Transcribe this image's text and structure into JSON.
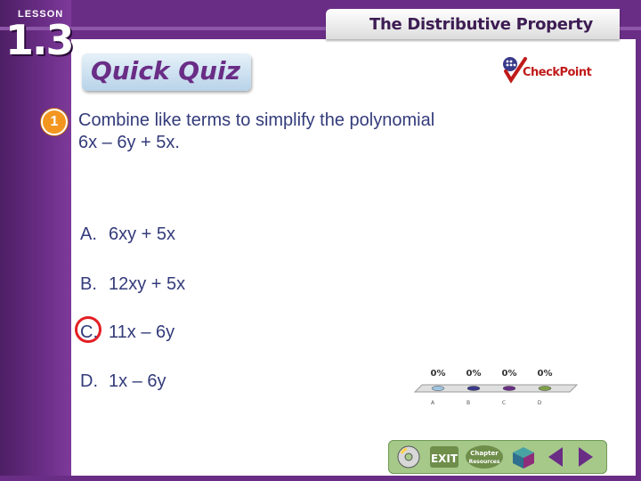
{
  "lesson": {
    "label": "LESSON",
    "number": "1.3"
  },
  "header": {
    "title": "The Distributive Property"
  },
  "quiz": {
    "heading": "Quick Quiz"
  },
  "checkpoint": {
    "label": "CheckPoint"
  },
  "question": {
    "number": "1",
    "text_line1": "Combine like terms to simplify the polynomial",
    "text_line2": "6x – 6y + 5x."
  },
  "answers": [
    {
      "letter": "A.",
      "text": "6xy + 5x"
    },
    {
      "letter": "B.",
      "text": "12xy + 5x"
    },
    {
      "letter": "C.",
      "text": "11x – 6y",
      "selected": true
    },
    {
      "letter": "D.",
      "text": "1x – 6y"
    }
  ],
  "chart_data": {
    "type": "bar",
    "categories": [
      "A",
      "B",
      "C",
      "D"
    ],
    "values": [
      0,
      0,
      0,
      0
    ],
    "data_labels": [
      "0%",
      "0%",
      "0%",
      "0%"
    ],
    "colors": [
      "#9ec6e3",
      "#3a3a8a",
      "#6a2d86",
      "#7fa04a"
    ],
    "ylim": [
      0,
      100
    ]
  },
  "nav": {
    "buttons": [
      "cd-icon",
      "exit-button",
      "chapter-resources-button",
      "menu-button",
      "previous-button",
      "next-button"
    ],
    "exit_label": "EXIT",
    "chapter_label": "Chapter Resources"
  },
  "colors": {
    "frame": "#6a2d86",
    "text": "#333b7a",
    "accent": "#f3961f",
    "highlight": "#e31e24"
  }
}
